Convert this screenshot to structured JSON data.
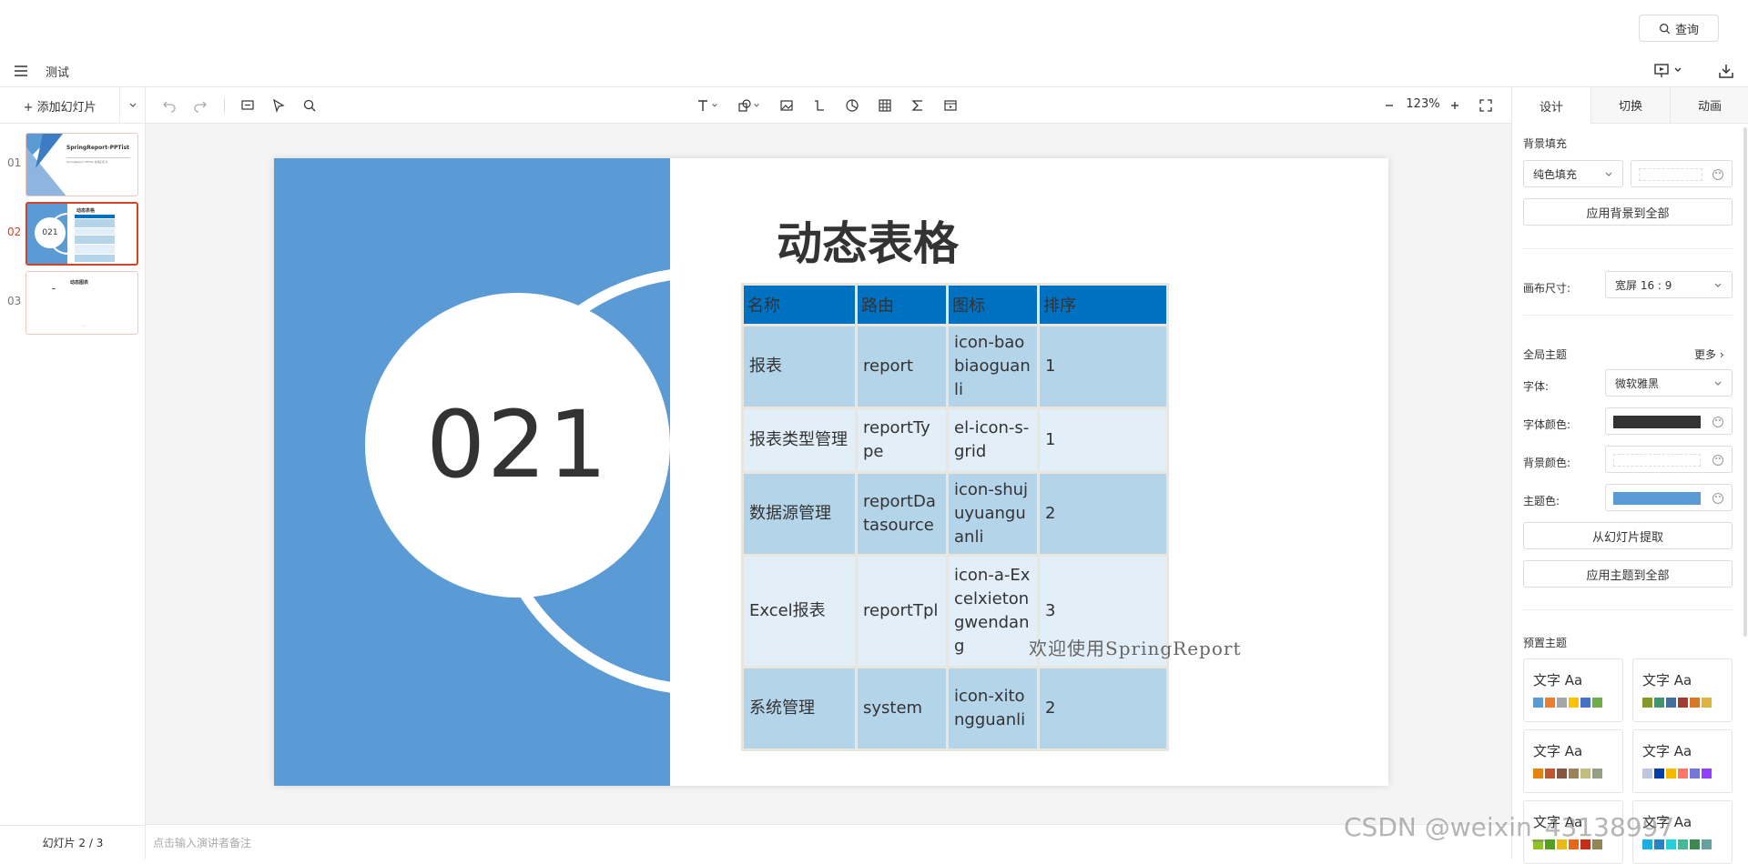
{
  "header": {
    "query_label": "查询",
    "doc_title": "测试"
  },
  "toolbar": {
    "add_slide_label": "+ 添加幻灯片",
    "zoom": "123%"
  },
  "thumbnails": [
    {
      "num": "01",
      "title": "SpringReport-PPTist",
      "subtitle": "SpringReport-PPTist 在线幻灯片"
    },
    {
      "num": "02",
      "title": "动态表格",
      "number": "021"
    },
    {
      "num": "03",
      "title": "动态图表",
      "footnote": "…"
    }
  ],
  "slide_counter": "幻灯片 2 / 3",
  "notes_placeholder": "点击输入演讲者备注",
  "slide": {
    "number": "021",
    "title": "动态表格",
    "table": {
      "headers": [
        "名称",
        "路由",
        "图标",
        "排序"
      ],
      "rows": [
        [
          "报表",
          "report",
          "icon-baobiaoguanli",
          "1"
        ],
        [
          "报表类型管理",
          "reportType",
          "el-icon-s-grid",
          "1"
        ],
        [
          "数据源管理",
          "reportDatasource",
          "icon-shujuyuanguanli",
          "2"
        ],
        [
          "Excel报表",
          "reportTpl",
          "icon-a-Excelxietongwendang",
          "3"
        ],
        [
          "系统管理",
          "system",
          "icon-xitongguanli",
          "2"
        ]
      ]
    },
    "watermark": "欢迎使用SpringReport"
  },
  "right_panel": {
    "tabs": [
      "设计",
      "切换",
      "动画"
    ],
    "bg_fill_label": "背景填充",
    "bg_fill_type": "纯色填充",
    "apply_bg_all": "应用背景到全部",
    "canvas_size_label": "画布尺寸:",
    "canvas_size": "宽屏 16 : 9",
    "global_theme_label": "全局主题",
    "more_label": "更多",
    "font_label": "字体:",
    "font_value": "微软雅黑",
    "font_color_label": "字体颜色:",
    "font_color": "#333333",
    "bg_color_label": "背景颜色:",
    "bg_color": "#ffffff",
    "theme_color_label": "主题色:",
    "theme_color": "#5b9bd5",
    "extract_label": "从幻灯片提取",
    "apply_theme_all": "应用主题到全部",
    "preset_label": "预置主题",
    "preset_text": "文字 Aa",
    "presets": [
      [
        "#5b9bd5",
        "#ed7d31",
        "#a5a5a5",
        "#ffc000",
        "#4472c4",
        "#70ad47"
      ],
      [
        "#83992a",
        "#3c9770",
        "#44709d",
        "#a23b32",
        "#d87728",
        "#deb340"
      ],
      [
        "#e48312",
        "#bd582c",
        "#865640",
        "#9b8357",
        "#c2bc80",
        "#94a088"
      ],
      [
        "#bdc8df",
        "#003fa9",
        "#f5ba00",
        "#ff7567",
        "#7676d9",
        "#923ffc"
      ],
      [
        "#90c226",
        "#54a021",
        "#e6b91e",
        "#e76618",
        "#c42f1a",
        "#918655"
      ],
      [
        "#1cade4",
        "#2683c6",
        "#27ced7",
        "#42ba97",
        "#3e8853",
        "#62a39f"
      ]
    ]
  },
  "watermark_csdn": "CSDN @weixin_43138997"
}
